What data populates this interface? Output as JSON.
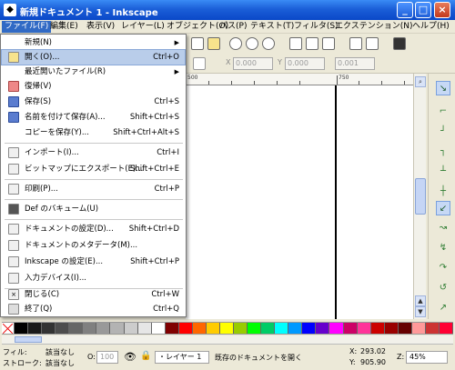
{
  "window": {
    "title": "新規ドキュメント 1 - Inkscape",
    "minimize": "_",
    "maximize": "□",
    "close": "×"
  },
  "menubar": [
    "ファイル(F)",
    "編集(E)",
    "表示(V)",
    "レイヤー(L)",
    "オブジェクト(O)",
    "パス(P)",
    "テキスト(T)",
    "フィルタ(S)",
    "エクステンション(N)",
    "ヘルプ(H)"
  ],
  "file_menu": {
    "items": [
      {
        "label": "新規(N)",
        "shortcut": "",
        "submenu": true,
        "icon": "blank-icon"
      },
      {
        "label": "開く(O)...",
        "shortcut": "Ctrl+O",
        "submenu": false,
        "icon": "open-folder-icon"
      },
      {
        "label": "最近開いたファイル(R)",
        "shortcut": "",
        "submenu": true,
        "icon": "blank-icon"
      },
      {
        "label": "復帰(V)",
        "shortcut": "",
        "submenu": false,
        "icon": "revert-icon"
      },
      {
        "label": "保存(S)",
        "shortcut": "Ctrl+S",
        "submenu": false,
        "icon": "save-icon"
      },
      {
        "label": "名前を付けて保存(A)...",
        "shortcut": "Shift+Ctrl+S",
        "submenu": false,
        "icon": "save-as-icon"
      },
      {
        "label": "コピーを保存(Y)...",
        "shortcut": "Shift+Ctrl+Alt+S",
        "submenu": false,
        "icon": "blank-icon"
      },
      {
        "label": "インポート(I)...",
        "shortcut": "Ctrl+I",
        "submenu": false,
        "icon": "import-icon"
      },
      {
        "label": "ビットマップにエクスポート(E)...",
        "shortcut": "Shift+Ctrl+E",
        "submenu": false,
        "icon": "export-icon"
      },
      {
        "label": "印刷(P)...",
        "shortcut": "Ctrl+P",
        "submenu": false,
        "icon": "print-icon"
      },
      {
        "label": "Def のバキューム(U)",
        "shortcut": "",
        "submenu": false,
        "icon": "vacuum-icon"
      },
      {
        "label": "ドキュメントの設定(D)...",
        "shortcut": "Shift+Ctrl+D",
        "submenu": false,
        "icon": "document-properties-icon"
      },
      {
        "label": "ドキュメントのメタデータ(M)...",
        "shortcut": "",
        "submenu": false,
        "icon": "metadata-icon"
      },
      {
        "label": "Inkscape の設定(E)...",
        "shortcut": "Shift+Ctrl+P",
        "submenu": false,
        "icon": "preferences-icon"
      },
      {
        "label": "入力デバイス(I)...",
        "shortcut": "",
        "submenu": false,
        "icon": "input-devices-icon"
      },
      {
        "label": "閉じる(C)",
        "shortcut": "Ctrl+W",
        "submenu": false,
        "icon": "close-doc-icon"
      },
      {
        "label": "終了(Q)",
        "shortcut": "Ctrl+Q",
        "submenu": false,
        "icon": "quit-icon"
      }
    ]
  },
  "toolbar": {
    "x_label": "X",
    "x_value": "0.000",
    "y_label": "Y",
    "y_value": "0.000",
    "w_value": "0.001",
    "text_tool_glyph": "T"
  },
  "ruler": {
    "labels": [
      "500",
      "750"
    ]
  },
  "status": {
    "fill_label": "フィル:",
    "fill_value": "該当なし",
    "stroke_label": "ストローク:",
    "stroke_value": "該当なし",
    "opacity_label": "O:",
    "opacity_value": "100",
    "layer": "・レイヤー 1",
    "message": "既存のドキュメントを開く",
    "x_label": "X:",
    "x_value": "293.02",
    "y_label": "Y:",
    "y_value": "905.90",
    "zoom_label": "Z:",
    "zoom_value": "45%"
  },
  "palette_colors": [
    "#000000",
    "#1a1a1a",
    "#333333",
    "#4d4d4d",
    "#666666",
    "#808080",
    "#999999",
    "#b3b3b3",
    "#cccccc",
    "#e6e6e6",
    "#ffffff",
    "#800000",
    "#ff0000",
    "#ff6600",
    "#ffcc00",
    "#ffff00",
    "#99cc00",
    "#00ff00",
    "#00cc66",
    "#00ffff",
    "#0099ff",
    "#0000ff",
    "#6600cc",
    "#ff00ff",
    "#cc0066",
    "#ff3399",
    "#cc0000",
    "#990000",
    "#660000",
    "#ff9999",
    "#cc3333",
    "#ff0033"
  ]
}
